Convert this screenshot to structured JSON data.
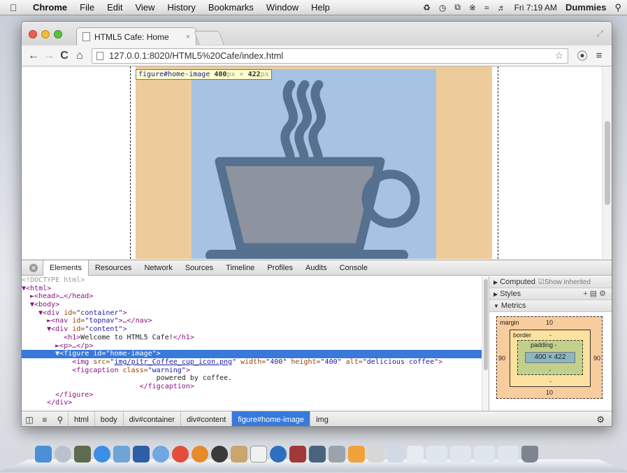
{
  "menubar": {
    "app": "Chrome",
    "items": [
      "File",
      "Edit",
      "View",
      "History",
      "Bookmarks",
      "Window",
      "Help"
    ],
    "clock": "Fri 7:19 AM",
    "user": "Dummies"
  },
  "tab": {
    "title": "HTML5 Cafe: Home",
    "close": "×"
  },
  "address": {
    "url": "127.0.0.1:8020/HTML5%20Cafe/index.html"
  },
  "tooltip": {
    "selector": "figure#home-image",
    "width": "400",
    "height": "422",
    "unit": "px",
    "times": "×"
  },
  "devtools": {
    "tabs": [
      "Elements",
      "Resources",
      "Network",
      "Sources",
      "Timeline",
      "Profiles",
      "Audits",
      "Console"
    ],
    "dom": {
      "l0": "<!DOCTYPE html>",
      "l1": "▼<html>",
      "l2": "  ►<head>…</head>",
      "l3": "  ▼<body>",
      "l4_tag": "    ▼<div ",
      "l4_attr": "id=",
      "l4_val": "\"container\"",
      "l4_end": ">",
      "l5_tag": "      ►<nav ",
      "l5_attr": "id=",
      "l5_val": "\"topnav\"",
      "l5_end": ">…</nav>",
      "l6_tag": "      ▼<div ",
      "l6_attr": "id=",
      "l6_val": "\"content\"",
      "l6_end": ">",
      "l7_open": "          <h1>",
      "l7_text": "Welcome to HTML5 Cafe!",
      "l7_close": "</h1>",
      "l8": "        ►<p>…</p>",
      "l9_tag": "        ▼<figure ",
      "l9_attr": "id=",
      "l9_val": "\"home-image\"",
      "l9_end": ">",
      "l10_tag": "            <img ",
      "l10_a1": "src=",
      "l10_link": "img/pitr_Coffee_cup_icon.png",
      "l10_a2": " width=",
      "l10_v2": "\"400\"",
      "l10_a3": " height=",
      "l10_v3": "\"400\"",
      "l10_a4": " alt=",
      "l10_v4": "\"delicious coffee\"",
      "l10_end": ">",
      "l11_tag": "            <figcaption ",
      "l11_attr": "class=",
      "l11_val": "\"warning\"",
      "l11_end": ">",
      "l12": "                                powered by coffee.",
      "l13": "                            </figcaption>",
      "l14": "        </figure>",
      "l15": "      </div>"
    },
    "side": {
      "computed": "Computed",
      "show_inherited": "Show inherited",
      "styles": "Styles",
      "metrics": "Metrics"
    },
    "metrics": {
      "margin_label": "margin",
      "margin_top": "10",
      "margin_bottom": "10",
      "margin_left": "90",
      "margin_right": "90",
      "border_label": "border",
      "dash": "-",
      "padding_label": "padding -",
      "content": "400 × 422"
    },
    "breadcrumbs": [
      "html",
      "body",
      "div#container",
      "div#content",
      "figure#home-image",
      "img"
    ]
  },
  "colors": {
    "selection": "#3879d9",
    "image_bg": "#a7c2e3",
    "margin_overlay": "#eecb9b",
    "cup": "#56708f",
    "cup_fill": "#8e93a0"
  }
}
